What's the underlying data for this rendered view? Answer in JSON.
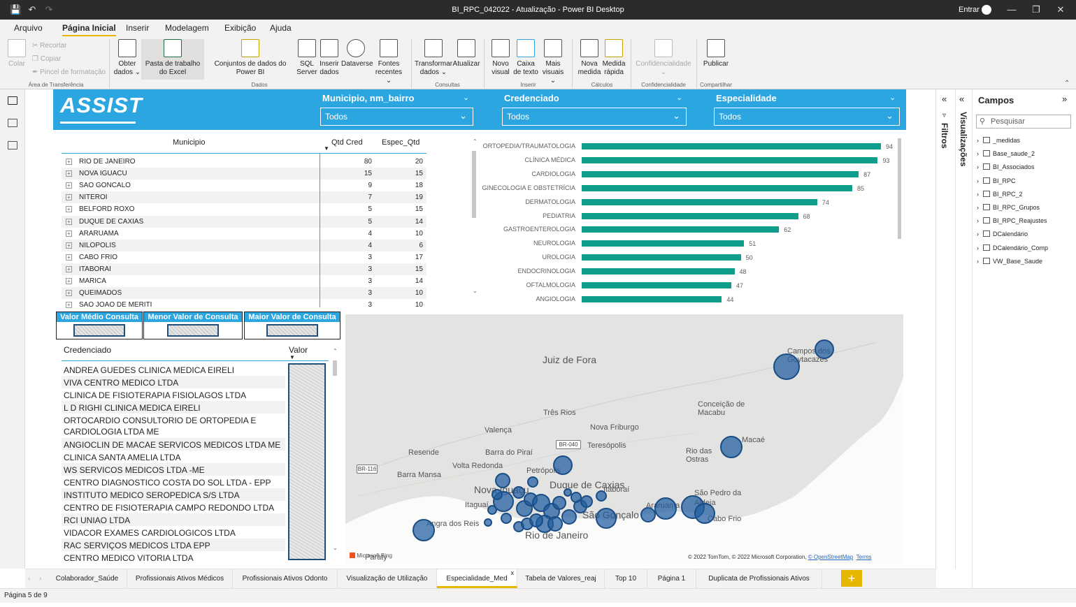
{
  "window": {
    "title": "BI_RPC_042022 - Atualização - Power BI Desktop",
    "signin": "Entrar"
  },
  "menu": {
    "tabs": [
      "Arquivo",
      "Página Inicial",
      "Inserir",
      "Modelagem",
      "Exibição",
      "Ajuda"
    ],
    "active": 1
  },
  "ribbon": {
    "clipboard": {
      "paste": "Colar",
      "cut": "Recortar",
      "copy": "Copiar",
      "format_painter": "Pincel de formatação",
      "group": "Área de Transferência"
    },
    "data": {
      "get_data": "Obter dados",
      "excel": "Pasta de trabalho do Excel",
      "datasets": "Conjuntos de dados do Power BI",
      "sql": "SQL Server",
      "enter_data": "Inserir dados",
      "dataverse": "Dataverse",
      "recent": "Fontes recentes",
      "group": "Dados"
    },
    "queries": {
      "transform": "Transformar dados",
      "refresh": "Atualizar",
      "group": "Consultas"
    },
    "insert": {
      "new_visual": "Novo visual",
      "text_box": "Caixa de texto",
      "more_visuals": "Mais visuais",
      "group": "Inserir"
    },
    "calc": {
      "new_measure": "Nova medida",
      "quick_measure": "Medida rápida",
      "group": "Cálculos"
    },
    "sensitivity": {
      "label": "Confidencialidade",
      "group": "Confidencialidade"
    },
    "share": {
      "publish": "Publicar",
      "group": "Compartilhar"
    }
  },
  "report": {
    "logo": "ASSIST",
    "slicers": [
      {
        "label": "Municipio, nm_bairro",
        "value": "Todos"
      },
      {
        "label": "Credenciado",
        "value": "Todos"
      },
      {
        "label": "Especialidade",
        "value": "Todos"
      }
    ],
    "table": {
      "headers": [
        "Municipio",
        "Qtd Cred",
        "Espec_Qtd"
      ],
      "rows": [
        [
          "RIO DE JANEIRO",
          "80",
          "20"
        ],
        [
          "NOVA IGUACU",
          "15",
          "15"
        ],
        [
          "SAO GONCALO",
          "9",
          "18"
        ],
        [
          "NITEROI",
          "7",
          "19"
        ],
        [
          "BELFORD ROXO",
          "5",
          "15"
        ],
        [
          "DUQUE DE CAXIAS",
          "5",
          "14"
        ],
        [
          "ARARUAMA",
          "4",
          "10"
        ],
        [
          "NILOPOLIS",
          "4",
          "6"
        ],
        [
          "CABO FRIO",
          "3",
          "17"
        ],
        [
          "ITABORAI",
          "3",
          "15"
        ],
        [
          "MARICA",
          "3",
          "14"
        ],
        [
          "QUEIMADOS",
          "3",
          "10"
        ],
        [
          "SAO JOAO DE MERITI",
          "3",
          "10"
        ]
      ]
    },
    "chart_data": {
      "type": "bar",
      "categories": [
        "ORTOPEDIA/TRAUMATOLOGIA",
        "CLÍNICA MÉDICA",
        "CARDIOLOGIA",
        "GINECOLOGIA E OBSTETRÍCIA",
        "DERMATOLOGIA",
        "PEDIATRIA",
        "GASTROENTEROLOGIA",
        "NEUROLOGIA",
        "UROLOGIA",
        "ENDOCRINOLOGIA",
        "OFTALMOLOGIA",
        "ANGIOLOGIA"
      ],
      "values": [
        94,
        93,
        87,
        85,
        74,
        68,
        62,
        51,
        50,
        48,
        47,
        44
      ],
      "orientation": "horizontal",
      "color": "#0f9e8c",
      "xlim": [
        0,
        94
      ]
    },
    "cards": [
      "Valor Médio Consulta",
      "Menor Valor de Consulta",
      "Maior Valor de Consulta"
    ],
    "credenciados": {
      "headers": [
        "Credenciado",
        "Valor"
      ],
      "rows": [
        "ANDREA GUEDES CLINICA MEDICA EIRELI",
        "VIVA CENTRO MEDICO LTDA",
        "CLINICA DE FISIOTERAPIA FISIOLAGOS LTDA",
        "L D RIGHI CLINICA MEDICA EIRELI",
        "ORTOCARDIO CONSULTORIO DE ORTOPEDIA E CARDIOLOGIA LTDA ME",
        "ANGIOCLIN DE MACAE SERVICOS MEDICOS LTDA ME",
        "CLINICA SANTA AMELIA LTDA",
        "WS SERVICOS MEDICOS LTDA -ME",
        "CENTRO DIAGNOSTICO COSTA DO SOL LTDA - EPP",
        "INSTITUTO MEDICO SEROPEDICA S/S LTDA",
        "CENTRO DE FISIOTERAPIA CAMPO REDONDO LTDA",
        "RCI UNIAO LTDA",
        "VIDACOR EXAMES CARDIOLOGICOS LTDA",
        "RAC SERVIÇOS MEDICOS LTDA EPP",
        "CENTRO MEDICO VITORIA LTDA"
      ]
    },
    "map": {
      "places": [
        "Juiz de Fora",
        "Campos dos Goytacazes",
        "Três Rios",
        "Conceição de Macabu",
        "Valença",
        "Nova Friburgo",
        "Teresópolis",
        "Barra do Piraí",
        "Resende",
        "Volta Redonda",
        "Barra Mansa",
        "Petrópolis",
        "Nova Iguaçu",
        "Duque de Caxias",
        "Itaboraí",
        "Rio das Ostras",
        "Macaé",
        "São Pedro da Aldeia",
        "Araruama",
        "Cabo Frio",
        "São Gonçalo",
        "Itaguaí",
        "Angra dos Reis",
        "Rio de Janeiro",
        "Paraty"
      ],
      "roads": [
        "BR-040",
        "BR-116"
      ],
      "brand": "Microsoft Bing",
      "attribution": "© 2022 TomTom, © 2022 Microsoft Corporation,",
      "osm": "© OpenStreetMap",
      "terms": "Terms"
    }
  },
  "page_tabs": [
    "Colaborador_Saúde",
    "Profissionais Ativos Médicos",
    "Profissionais Ativos Odonto",
    "Visualização de Utilização",
    "Especialidade_Med",
    "Tabela de Valores_reaj",
    "Top 10",
    "Página 1",
    "Duplicata de Profissionais Ativos Médicos"
  ],
  "active_tab": 4,
  "add_tab": "+",
  "status": "Página 5 de 9",
  "panes": {
    "filters": "Filtros",
    "visualizations": "Visualizações",
    "fields": "Campos",
    "search_placeholder": "Pesquisar",
    "field_list": [
      "_medidas",
      "Base_saude_2",
      "BI_Associados",
      "BI_RPC",
      "BI_RPC_2",
      "BI_RPC_Grupos",
      "BI_RPC_Reajustes",
      "DCalendário",
      "DCalendário_Comp",
      "VW_Base_Saude"
    ]
  },
  "colors": {
    "header": "#2ca6e0",
    "bar": "#0f9e8c",
    "bubble": "#1f5da0",
    "accent": "#e6b600"
  }
}
